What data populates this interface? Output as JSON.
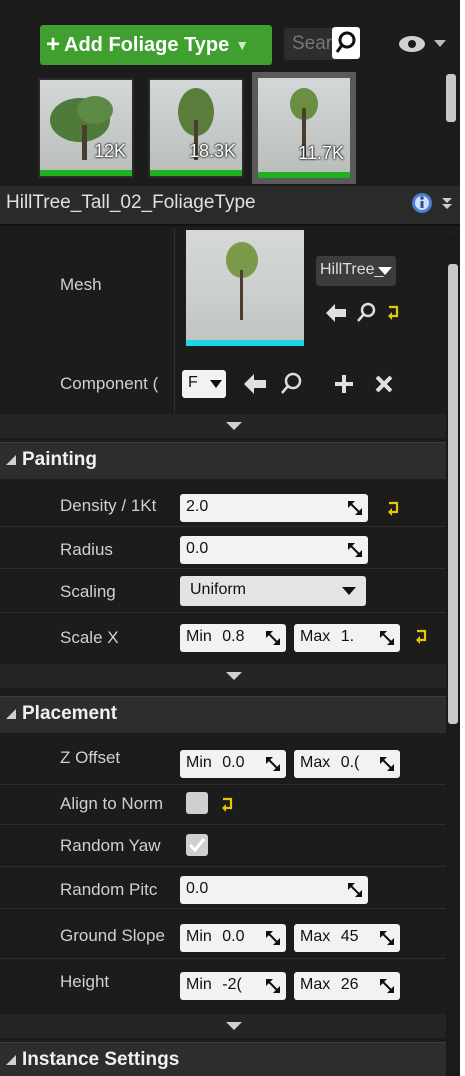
{
  "toolbar": {
    "add_foliage_label": "Add Foliage Type",
    "search_placeholder": "Searc"
  },
  "thumbnails": [
    {
      "count": "12K"
    },
    {
      "count": "18.3K"
    },
    {
      "count": "11.7K"
    }
  ],
  "foliage_type_name": "HillTree_Tall_02_FoliageType",
  "mesh": {
    "label": "Mesh",
    "asset_name": "HillTree_"
  },
  "component": {
    "label": "Component (",
    "value": "F"
  },
  "painting": {
    "title": "Painting",
    "density_label": "Density / 1Kt",
    "density_value": "2.0",
    "radius_label": "Radius",
    "radius_value": "0.0",
    "scaling_label": "Scaling",
    "scaling_value": "Uniform",
    "scale_x_label": "Scale X",
    "scale_x_min_label": "Min",
    "scale_x_min_value": "0.8",
    "scale_x_max_label": "Max",
    "scale_x_max_value": "1."
  },
  "placement": {
    "title": "Placement",
    "z_offset_label": "Z Offset",
    "z_offset_min_label": "Min",
    "z_offset_min_value": "0.0",
    "z_offset_max_label": "Max",
    "z_offset_max_value": "0.(",
    "align_label": "Align to Norm",
    "align_checked": false,
    "random_yaw_label": "Random Yaw",
    "random_yaw_checked": true,
    "random_pitch_label": "Random Pitc",
    "random_pitch_value": "0.0",
    "ground_slope_label": "Ground Slope",
    "ground_slope_min_label": "Min",
    "ground_slope_min_value": "0.0",
    "ground_slope_max_label": "Max",
    "ground_slope_max_value": "45",
    "height_label": "Height",
    "height_min_label": "Min",
    "height_min_value": "-2(",
    "height_max_label": "Max",
    "height_max_value": "26"
  },
  "instance_settings": {
    "title": "Instance Settings"
  },
  "colors": {
    "accent_green": "#3f9f2f",
    "panel_bg": "#1c1c1c",
    "reset_yellow": "#e6c800",
    "mesh_cyan": "#1ed6e6"
  }
}
